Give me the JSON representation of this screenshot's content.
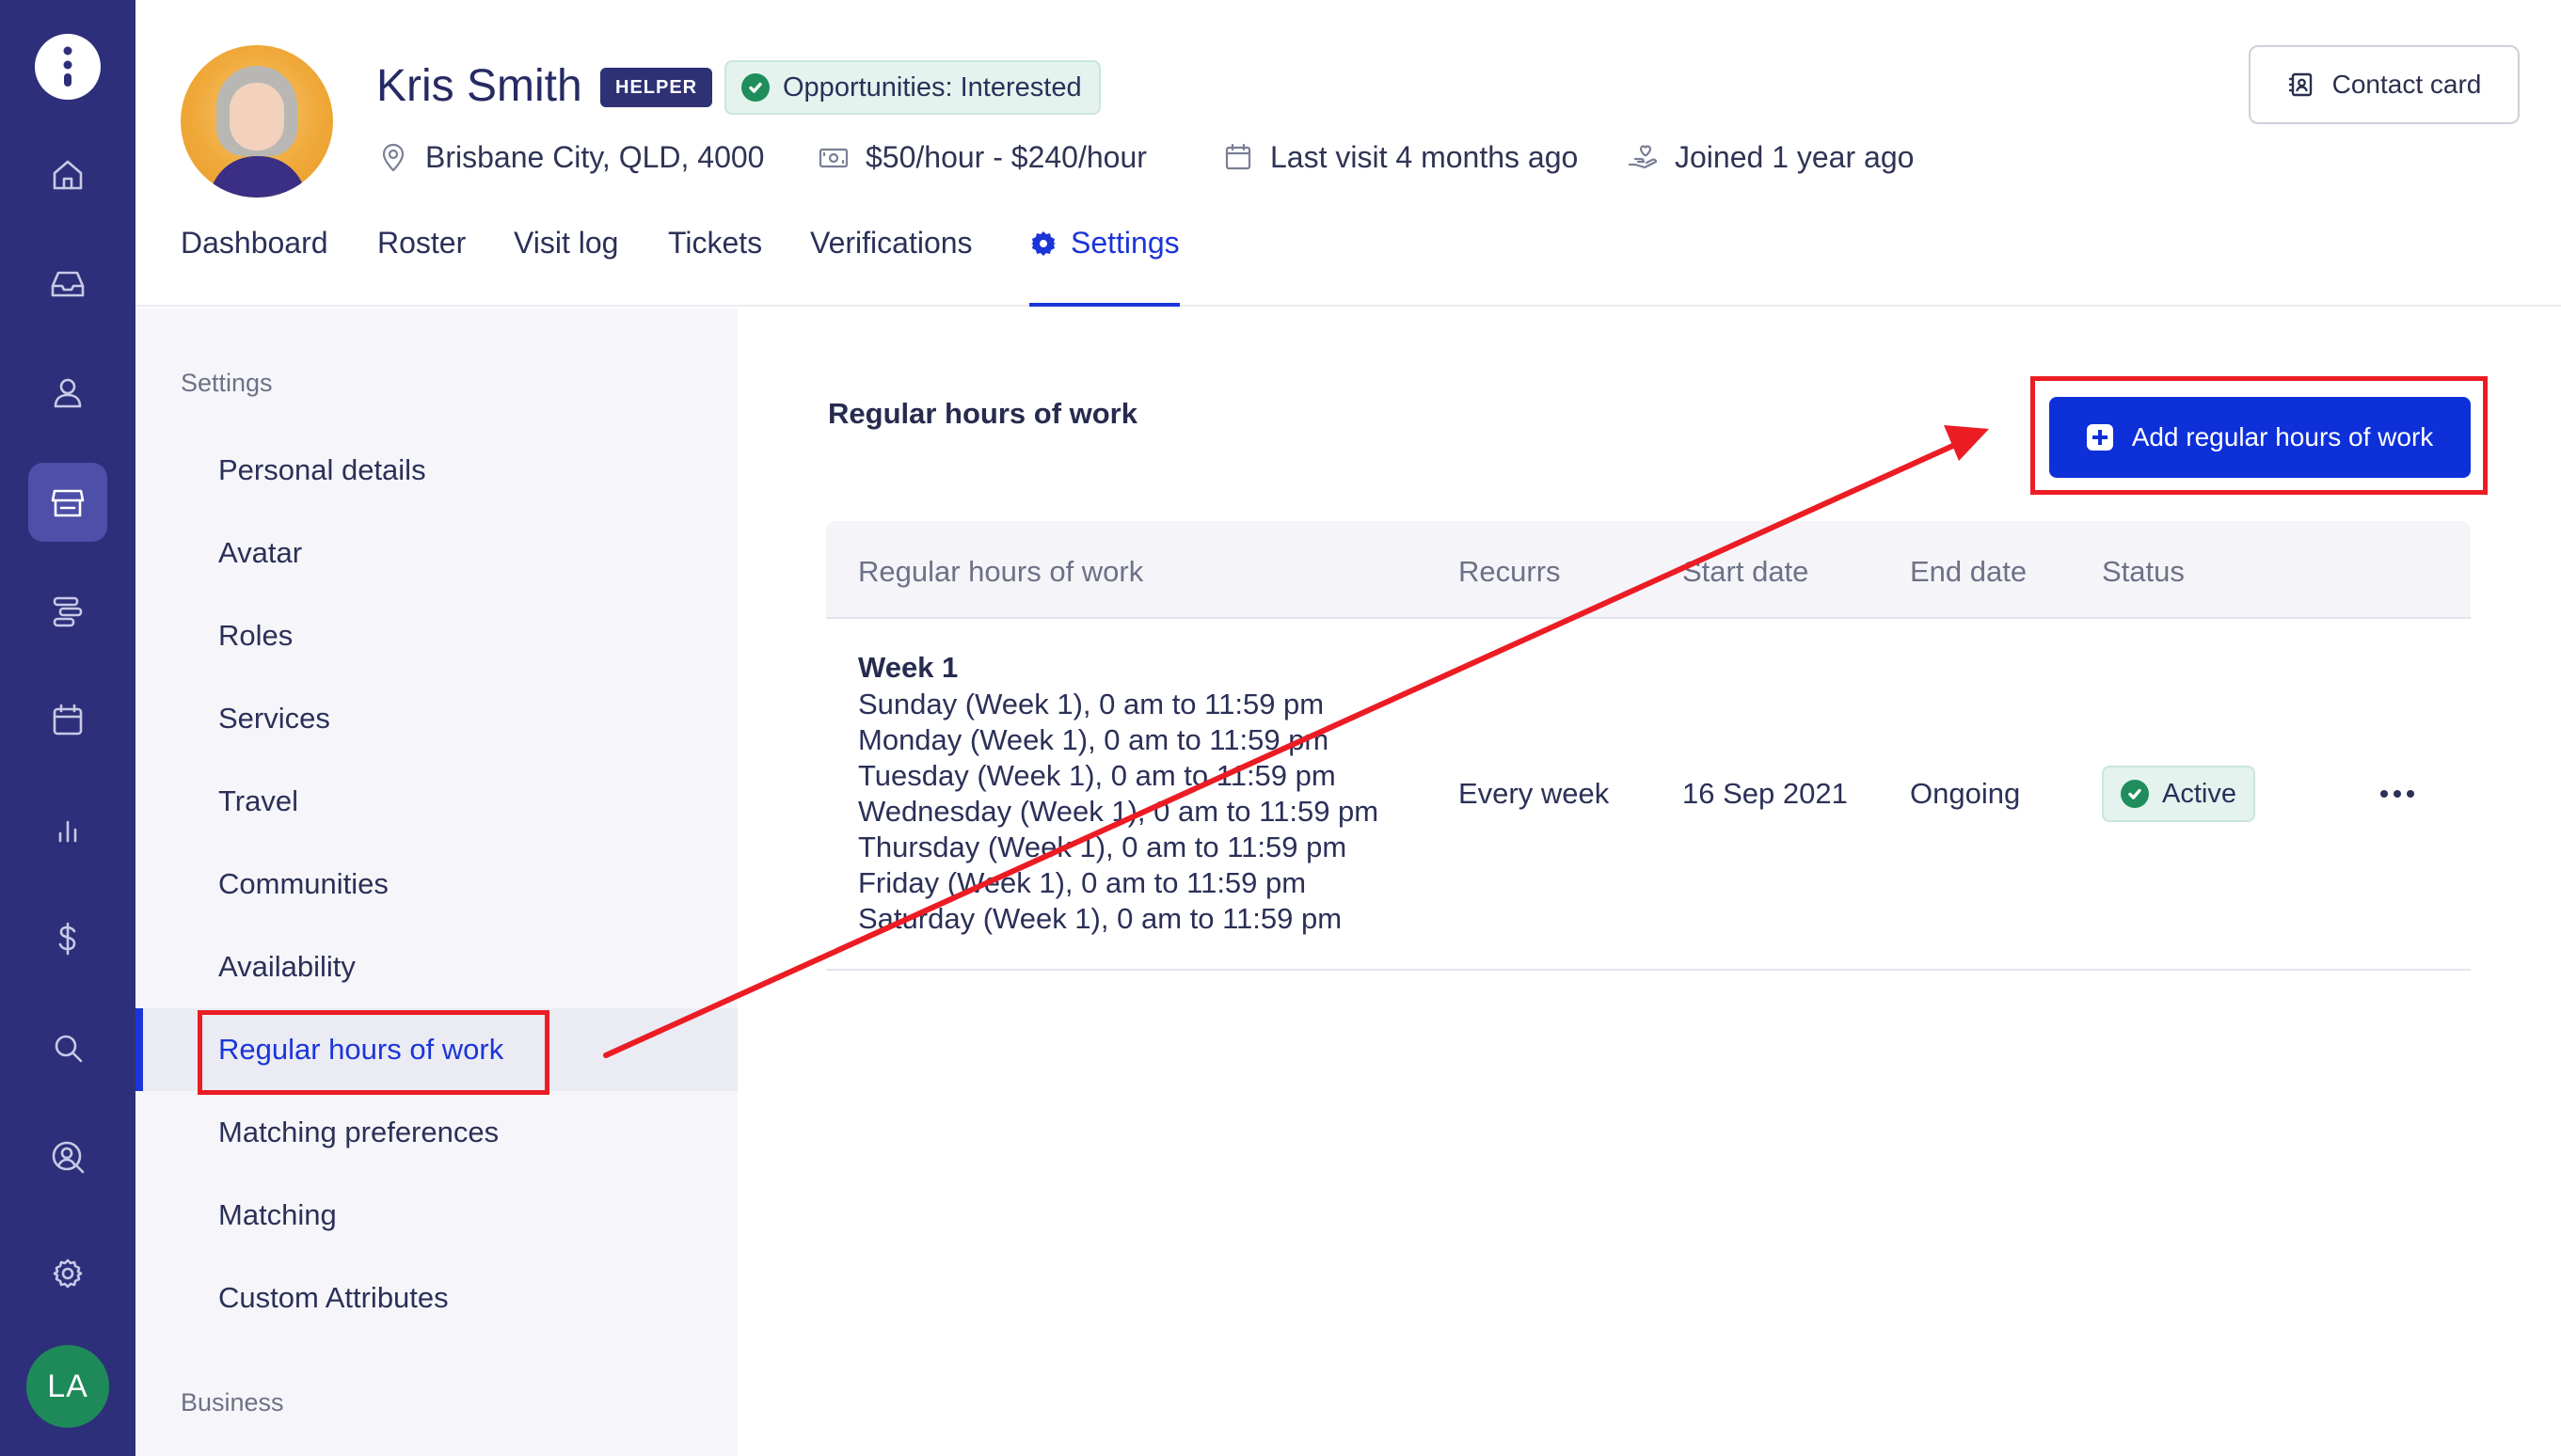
{
  "rail": {
    "items": [
      {
        "name": "logo-icon"
      },
      {
        "name": "home-icon"
      },
      {
        "name": "inbox-icon"
      },
      {
        "name": "person-icon"
      },
      {
        "name": "store-icon",
        "active": true
      },
      {
        "name": "roster-icon"
      },
      {
        "name": "calendar-icon"
      },
      {
        "name": "reports-icon"
      },
      {
        "name": "billing-icon"
      },
      {
        "name": "search-icon"
      },
      {
        "name": "user-search-icon"
      },
      {
        "name": "gear-icon"
      }
    ],
    "user_initials": "LA"
  },
  "profile": {
    "name": "Kris Smith",
    "role_badge": "HELPER",
    "opportunities_badge": "Opportunities: Interested",
    "location": "Brisbane City, QLD, 4000",
    "rate": "$50/hour - $240/hour",
    "last_visit": "Last visit 4 months ago",
    "joined": "Joined 1 year ago",
    "contact_card_label": "Contact card"
  },
  "tabs": [
    {
      "label": "Dashboard"
    },
    {
      "label": "Roster"
    },
    {
      "label": "Visit log"
    },
    {
      "label": "Tickets"
    },
    {
      "label": "Verifications"
    },
    {
      "label": "Settings",
      "active": true
    }
  ],
  "settings_nav": {
    "heading": "Settings",
    "items": [
      "Personal details",
      "Avatar",
      "Roles",
      "Services",
      "Travel",
      "Communities",
      "Availability",
      "Regular hours of work",
      "Matching preferences",
      "Matching",
      "Custom Attributes"
    ],
    "active_index": 7,
    "footer_heading": "Business"
  },
  "main": {
    "title": "Regular hours of work",
    "add_button_label": "Add regular hours of work",
    "table": {
      "columns": [
        "Regular hours of work",
        "Recurrs",
        "Start date",
        "End date",
        "Status"
      ],
      "rows": [
        {
          "week_title": "Week 1",
          "days": [
            "Sunday (Week 1), 0 am to 11:59 pm",
            "Monday (Week 1), 0 am to 11:59 pm",
            "Tuesday (Week 1), 0 am to 11:59 pm",
            "Wednesday (Week 1), 0 am to 11:59 pm",
            "Thursday (Week 1), 0 am to 11:59 pm",
            "Friday (Week 1), 0 am to 11:59 pm",
            "Saturday (Week 1), 0 am to 11:59 pm"
          ],
          "recurrs": "Every week",
          "start_date": "16 Sep 2021",
          "end_date": "Ongoing",
          "status": "Active"
        }
      ]
    }
  },
  "colors": {
    "rail_bg": "#2e2f7a",
    "accent_blue": "#1b35d8",
    "primary_button": "#0d30d9",
    "annotation_red": "#ec1c24",
    "success_green": "#1f8d5c"
  }
}
